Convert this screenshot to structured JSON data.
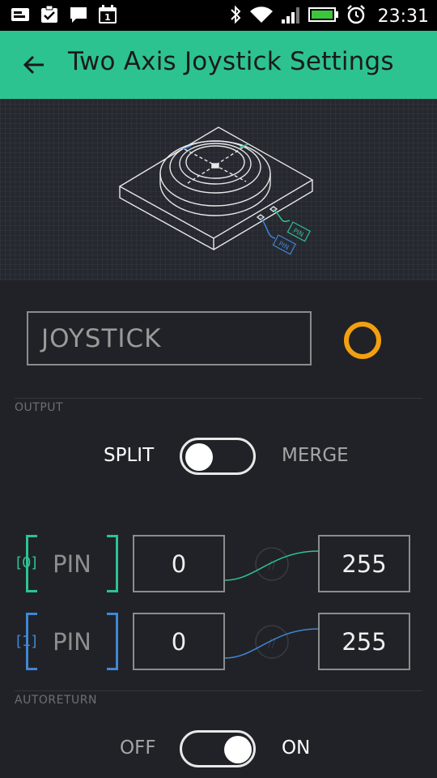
{
  "status_bar": {
    "time": "23:31",
    "icons": [
      "image-notification-icon",
      "task-check-icon",
      "message-icon",
      "calendar-icon",
      "bluetooth-icon",
      "wifi-icon",
      "signal-icon",
      "battery-icon",
      "alarm-icon"
    ],
    "calendar_day": "1"
  },
  "app_bar": {
    "title": "Two Axis Joystick Settings",
    "background": "#2dc391"
  },
  "illustration": {
    "pin_labels": [
      "PIN",
      "PIN"
    ]
  },
  "name_field": {
    "value": "JOYSTICK"
  },
  "color_picker": {
    "color": "#f29f10"
  },
  "output": {
    "label": "OUTPUT",
    "left_option": "SPLIT",
    "right_option": "MERGE",
    "selected": "SPLIT"
  },
  "pins": [
    {
      "index_label": "[0]",
      "pin_label": "PIN",
      "min": "0",
      "max": "255",
      "color": "#2dc391"
    },
    {
      "index_label": "[1]",
      "pin_label": "PIN",
      "min": "0",
      "max": "255",
      "color": "#3f86d6"
    }
  ],
  "autoreturn": {
    "label": "AUTORETURN",
    "off_label": "OFF",
    "on_label": "ON",
    "state": "ON"
  }
}
